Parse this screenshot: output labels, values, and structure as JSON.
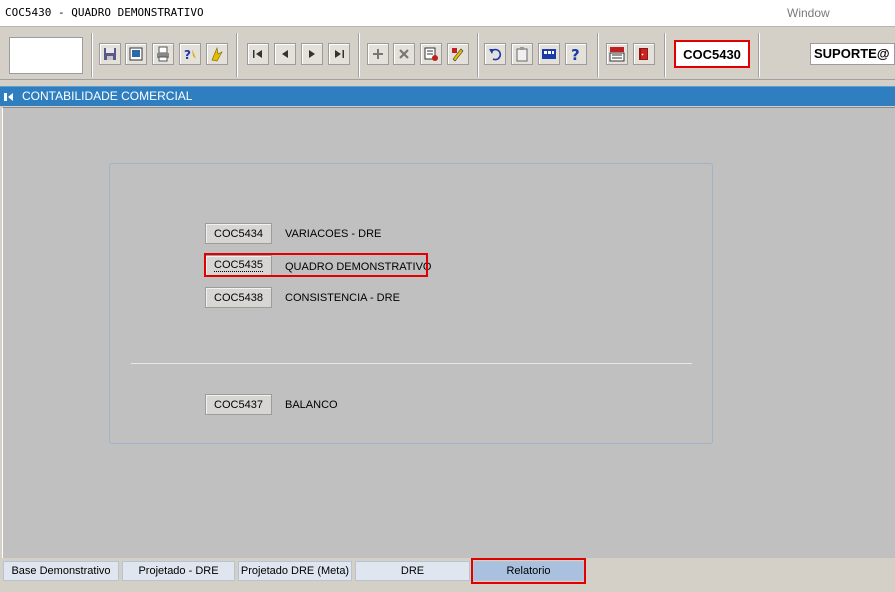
{
  "window": {
    "title": "COC5430 - QUADRO DEMONSTRATIVO",
    "menu_window": "Window"
  },
  "toolbar": {
    "icons": [
      "save-icon",
      "window-icon",
      "print-icon",
      "query-help-icon",
      "execute-query-icon",
      "first-record-icon",
      "previous-record-icon",
      "next-record-icon",
      "last-record-icon",
      "insert-record-icon",
      "delete-record-icon",
      "list-values-icon",
      "edit-icon",
      "undo-icon",
      "clipboard-icon",
      "keys-icon",
      "help-icon",
      "menu-icon",
      "exit-icon"
    ],
    "module_code": "COC5430",
    "user": "SUPORTE@"
  },
  "form": {
    "header": "CONTABILIDADE COMERCIAL",
    "reports": [
      {
        "code": "COC5434",
        "label": "VARIACOES - DRE"
      },
      {
        "code": "COC5435",
        "label": "QUADRO DEMONSTRATIVO"
      },
      {
        "code": "COC5438",
        "label": "CONSISTENCIA - DRE"
      },
      {
        "code": "COC5437",
        "label": "BALANCO"
      }
    ]
  },
  "tabs": [
    {
      "label": "Base Demonstrativo"
    },
    {
      "label": "Projetado - DRE"
    },
    {
      "label": "Projetado DRE (Meta)"
    },
    {
      "label": "DRE"
    },
    {
      "label": "Relatorio"
    }
  ],
  "colors": {
    "header_bar": "#2f7fc0",
    "highlight": "#e00000",
    "active_tab": "#a9c1de"
  }
}
